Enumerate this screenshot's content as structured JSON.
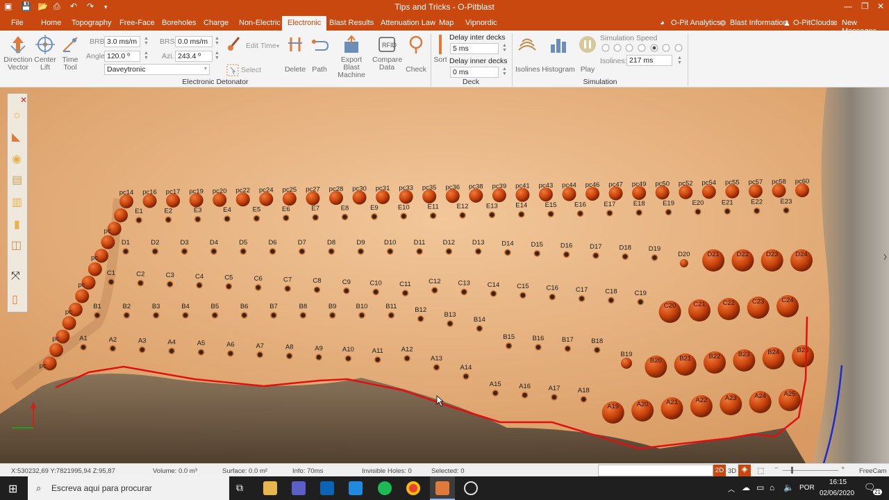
{
  "window": {
    "title": "Tips and Tricks - O-Pitblast"
  },
  "menu": {
    "items": [
      "File",
      "Home",
      "Topography",
      "Free-Face",
      "Boreholes",
      "Charge",
      "Non-Electric",
      "Electronic",
      "Blast Results",
      "Attenuation Law",
      "Map",
      "Vipnordic"
    ],
    "right": [
      "O-Pit Analytics",
      "Blast Information",
      "O-PitCloud",
      "New Messages"
    ]
  },
  "ribbon": {
    "direction_vector": "Direction Vector",
    "center_lift": "Center Lift",
    "time_tool": "Time Tool",
    "brb_label": "BRB",
    "brb_value": "3.0 ms/m",
    "angle_label": "Angle",
    "angle_value": "120.0 º",
    "brs_label": "BRS",
    "brs_value": "0.0 ms/m",
    "azi_label": "Azi.",
    "azi_value": "243.4 º",
    "detonator_value": "Daveytronic",
    "edit_time": "Edit Time",
    "select": "Select",
    "delete": "Delete",
    "path": "Path",
    "export_blast_machine": "Export Blast Machine",
    "compare_data": "Compare Data",
    "check": "Check",
    "group_electronic": "Electronic Detonator",
    "sort": "Sort",
    "delay_inter_label": "Delay inter decks",
    "delay_inter_value": "5 ms",
    "delay_inner_label": "Delay inner decks",
    "delay_inner_value": "0 ms",
    "group_deck": "Deck",
    "isolines": "Isolines",
    "histogram": "Histogram",
    "play": "Play",
    "sim_speed_label": "Simulation Speed",
    "isolines_label": "Isolines:",
    "isolines_value": "217 ms",
    "group_simulation": "Simulation"
  },
  "holes": {
    "pc_top": [
      "pc14",
      "pc16",
      "pc17",
      "pc19",
      "pc20",
      "pc22",
      "pc24",
      "pc25",
      "pc27",
      "pc28",
      "pc30",
      "pc31",
      "pc33",
      "pc35",
      "pc36",
      "pc38",
      "pc39",
      "pc41",
      "pc43",
      "pc44",
      "pc46",
      "pc47",
      "pc49",
      "pc50",
      "pc52",
      "pc54",
      "pc55",
      "pc57",
      "pc58",
      "pc60"
    ],
    "E": [
      "E1",
      "E2",
      "E3",
      "E4",
      "E5",
      "E6",
      "E7",
      "E8",
      "E9",
      "E10",
      "E11",
      "E12",
      "E13",
      "E14",
      "E15",
      "E16",
      "E17",
      "E18",
      "E19",
      "E20",
      "E21",
      "E22",
      "E23"
    ],
    "D": [
      "D1",
      "D2",
      "D3",
      "D4",
      "D5",
      "D6",
      "D7",
      "D8",
      "D9",
      "D10",
      "D11",
      "D12",
      "D13",
      "D14",
      "D15",
      "D16",
      "D17",
      "D18",
      "D19",
      "D20",
      "D21",
      "D22",
      "D23",
      "D24"
    ],
    "C": [
      "C1",
      "C2",
      "C3",
      "C4",
      "C5",
      "C6",
      "C7",
      "C8",
      "C9",
      "C10",
      "C11",
      "C12",
      "C13",
      "C14",
      "C15",
      "C16",
      "C17",
      "C18",
      "C19",
      "C20",
      "C21",
      "C22",
      "C23",
      "C24"
    ],
    "B": [
      "B1",
      "B2",
      "B3",
      "B4",
      "B5",
      "B6",
      "B7",
      "B8",
      "B9",
      "B10",
      "B11",
      "B12",
      "B13",
      "B14",
      "B15",
      "B16",
      "B17",
      "B18",
      "B19",
      "B20",
      "B21",
      "B22",
      "B23",
      "B24",
      "B25"
    ],
    "A": [
      "A1",
      "A2",
      "A3",
      "A4",
      "A5",
      "A6",
      "A7",
      "A8",
      "A9",
      "A10",
      "A11",
      "A12",
      "A13",
      "A14",
      "A15",
      "A16",
      "A17",
      "A18",
      "A19",
      "A20",
      "A21",
      "A22",
      "A23",
      "A24",
      "A25"
    ],
    "pc_left": "pc"
  },
  "status": {
    "coords": "X:530232,69   Y:7821995,94   Z:95,87",
    "volume": "Volume: 0.0 m³",
    "surface": "Surface: 0.0 m²",
    "info": "Info: 70ms",
    "invisible": "Invisible Holes: 0",
    "selected": "Selected: 0",
    "mode2d": "2D",
    "mode3d": "3D",
    "freecam": "FreeCam"
  },
  "taskbar": {
    "search_placeholder": "Escreva aqui para procurar",
    "lang": "POR",
    "time": "16:15",
    "date": "02/06/2020",
    "notif": "21"
  },
  "colors": {
    "brand": "#c9480f",
    "hole": "#c8430c",
    "boundary": "#e01010",
    "blue_line": "#1a2bd0"
  }
}
